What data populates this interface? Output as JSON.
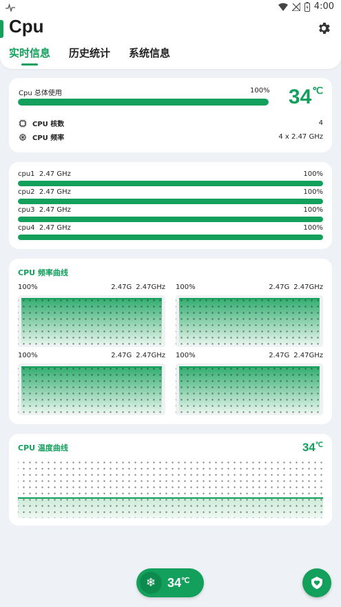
{
  "statusbar": {
    "time": "4:00"
  },
  "header": {
    "title": "Cpu",
    "tabs": [
      {
        "label": "实时信息",
        "active": true
      },
      {
        "label": "历史统计",
        "active": false
      },
      {
        "label": "系统信息",
        "active": false
      }
    ]
  },
  "overview": {
    "usage_label": "Cpu 总体使用",
    "usage_percent_text": "100%",
    "usage_value": 1.0,
    "temperature": "34",
    "temperature_unit": "℃",
    "cores_label": "CPU 核数",
    "cores_value": "4",
    "freq_label": "CPU 频率",
    "freq_value": "4 x 2.47 GHz"
  },
  "cores": [
    {
      "name": "cpu1",
      "freq": "2.47 GHz",
      "percent": "100%",
      "usage": 1.0
    },
    {
      "name": "cpu2",
      "freq": "2.47 GHz",
      "percent": "100%",
      "usage": 1.0
    },
    {
      "name": "cpu3",
      "freq": "2.47 GHz",
      "percent": "100%",
      "usage": 1.0
    },
    {
      "name": "cpu4",
      "freq": "2.47 GHz",
      "percent": "100%",
      "usage": 1.0
    }
  ],
  "freq_curve": {
    "title": "CPU 频率曲线",
    "graphs": [
      {
        "percent": "100%",
        "current": "2.47G",
        "max": "2.47GHz",
        "level": 1.0
      },
      {
        "percent": "100%",
        "current": "2.47G",
        "max": "2.47GHz",
        "level": 1.0
      },
      {
        "percent": "100%",
        "current": "2.47G",
        "max": "2.47GHz",
        "level": 1.0
      },
      {
        "percent": "100%",
        "current": "2.47G",
        "max": "2.47GHz",
        "level": 1.0
      }
    ]
  },
  "temp_curve": {
    "title": "CPU 温度曲线",
    "value": "34",
    "unit": "℃",
    "level": 0.34
  },
  "bottom": {
    "temperature": "34",
    "unit": "℃"
  },
  "colors": {
    "accent": "#12a05c",
    "background": "#eef1f5",
    "track": "#e3e8ee"
  }
}
